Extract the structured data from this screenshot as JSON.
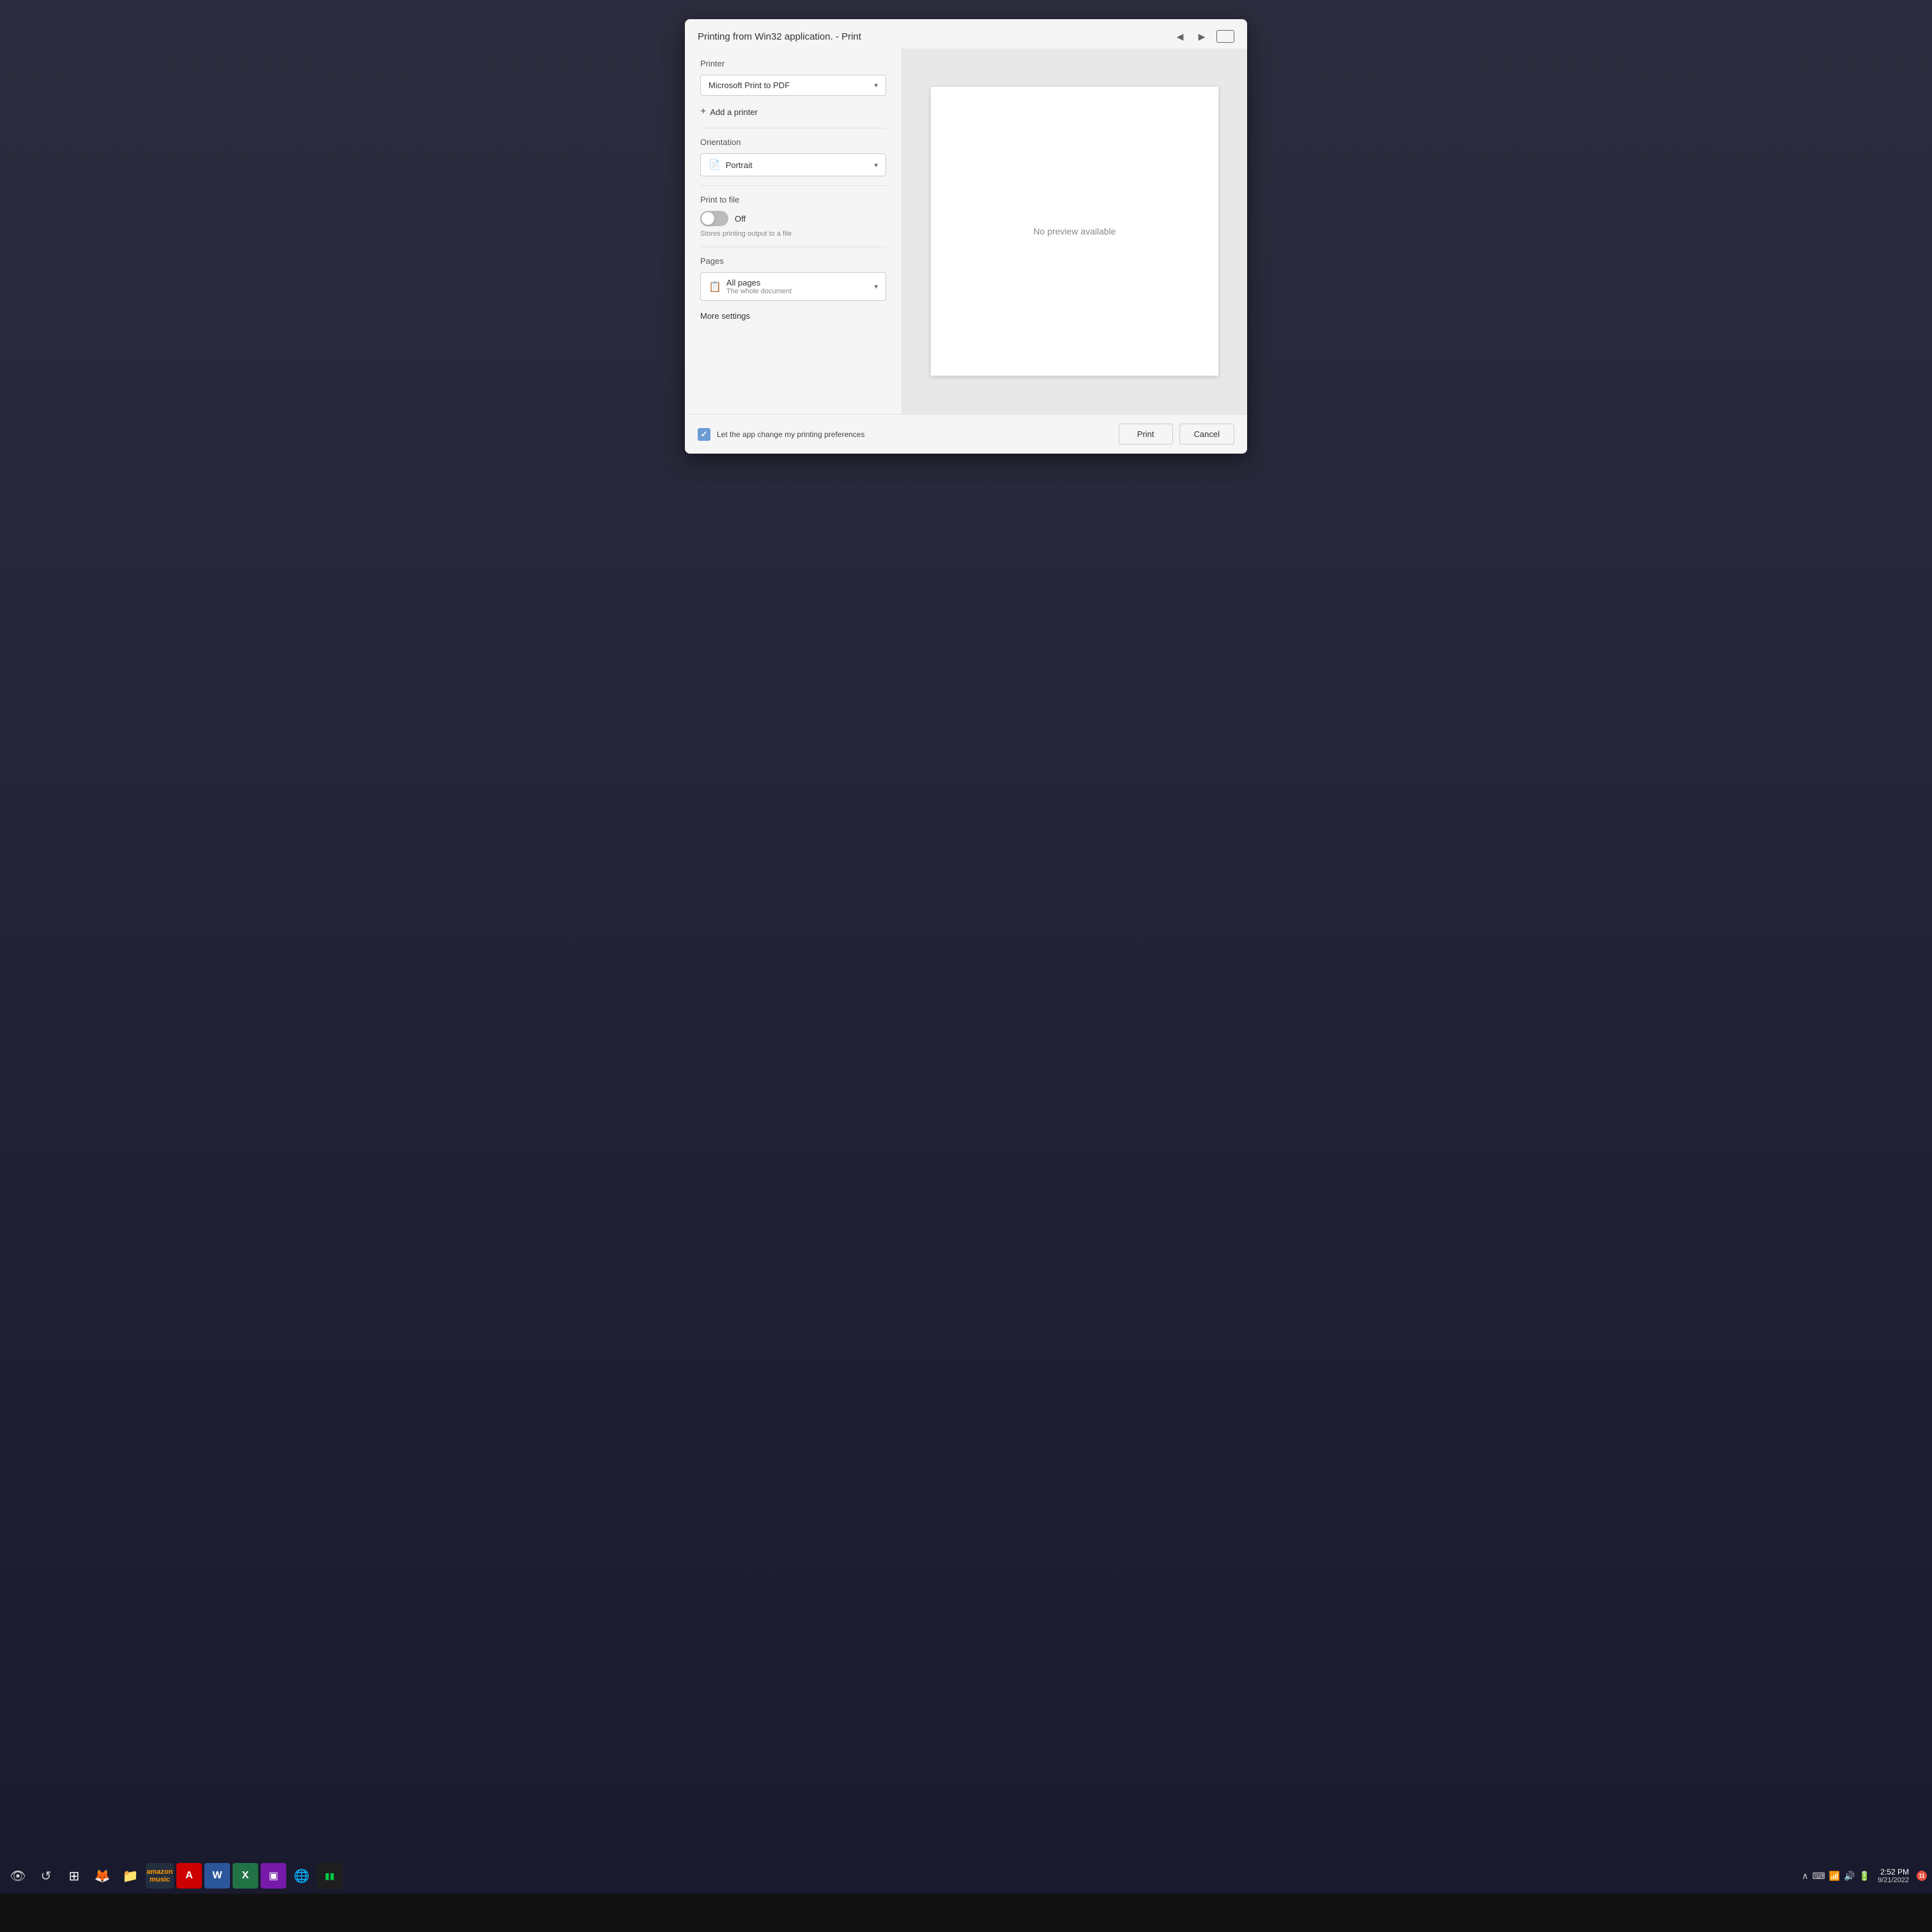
{
  "dialog": {
    "title": "Printing from Win32 application. - Print",
    "printer_label": "Printer",
    "printer_value": "Microsoft Print to PDF",
    "add_printer": "Add a printer",
    "orientation_label": "Orientation",
    "orientation_value": "Portrait",
    "print_to_file_label": "Print to file",
    "toggle_state": "Off",
    "toggle_hint": "Stores printing output to a file",
    "pages_label": "Pages",
    "pages_value": "All pages",
    "pages_sub": "The whole document",
    "more_settings": "More settings",
    "no_preview": "No preview available",
    "checkbox_label": "Let the app change my printing preferences",
    "print_button": "Print",
    "cancel_button": "Cancel"
  },
  "taskbar": {
    "icons": [
      {
        "name": "security-icon",
        "symbol": "👁",
        "class": "icon-security"
      },
      {
        "name": "refresh-icon",
        "symbol": "↺",
        "class": "icon-refresh"
      },
      {
        "name": "start-icon",
        "symbol": "⊞",
        "class": "icon-start"
      },
      {
        "name": "firefox-icon",
        "symbol": "🦊",
        "class": "icon-firefox"
      },
      {
        "name": "folder-icon",
        "symbol": "📁",
        "class": "icon-folder"
      },
      {
        "name": "amazon-music-icon",
        "symbol": "♪",
        "class": "icon-amazon"
      },
      {
        "name": "acrobat-icon",
        "symbol": "A",
        "class": "icon-acrobat"
      },
      {
        "name": "word-icon",
        "symbol": "W",
        "class": "icon-word"
      },
      {
        "name": "excel-icon",
        "symbol": "X",
        "class": "icon-excel"
      },
      {
        "name": "onenote-icon",
        "symbol": "▣",
        "class": "icon-onenote"
      },
      {
        "name": "chrome-icon",
        "symbol": "⬤",
        "class": "icon-chrome"
      },
      {
        "name": "terminal-icon",
        "symbol": "▮",
        "class": "icon-terminal"
      }
    ],
    "clock_time": "2:52 PM",
    "clock_date": "9/21/2022",
    "notification_count": "11"
  }
}
